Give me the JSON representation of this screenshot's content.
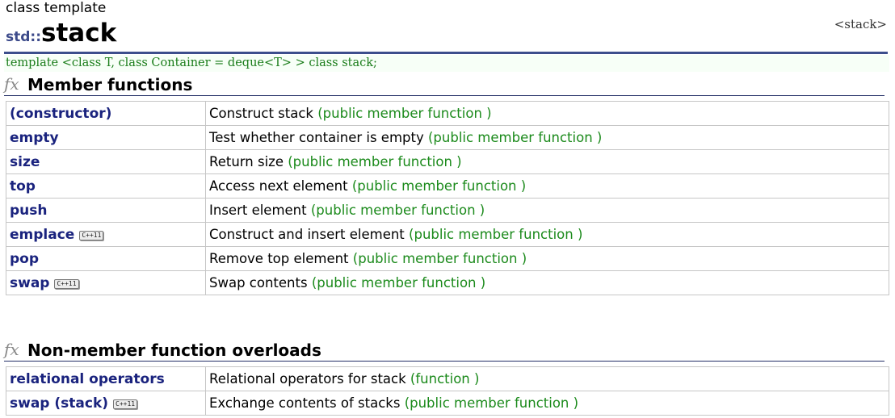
{
  "page": {
    "kind": "class template",
    "namespace": "std::",
    "name": "stack",
    "header": "<stack>",
    "declaration": "template <class T, class Container = deque<T> > class stack;"
  },
  "sections": {
    "fx_glyph": "fx",
    "member_functions_title": "Member functions",
    "non_member_title": "Non-member function overloads"
  },
  "member_functions": [
    {
      "name": "(constructor)",
      "badge": "",
      "desc": "Construct stack",
      "note": "(public member function )"
    },
    {
      "name": "empty",
      "badge": "",
      "desc": "Test whether container is empty",
      "note": "(public member function )"
    },
    {
      "name": "size",
      "badge": "",
      "desc": "Return size",
      "note": "(public member function )"
    },
    {
      "name": "top",
      "badge": "",
      "desc": "Access next element",
      "note": "(public member function )"
    },
    {
      "name": "push",
      "badge": "",
      "desc": "Insert element",
      "note": "(public member function )"
    },
    {
      "name": "emplace",
      "badge": "C++11",
      "desc": "Construct and insert element",
      "note": "(public member function )"
    },
    {
      "name": "pop",
      "badge": "",
      "desc": "Remove top element",
      "note": "(public member function )"
    },
    {
      "name": "swap",
      "badge": "C++11",
      "desc": "Swap contents",
      "note": "(public member function )"
    }
  ],
  "non_member_functions": [
    {
      "name": "relational operators",
      "badge": "",
      "desc": "Relational operators for stack",
      "note": "(function )"
    },
    {
      "name": "swap (stack)",
      "badge": "C++11",
      "desc": "Exchange contents of stacks",
      "note": "(public member function )"
    }
  ]
}
